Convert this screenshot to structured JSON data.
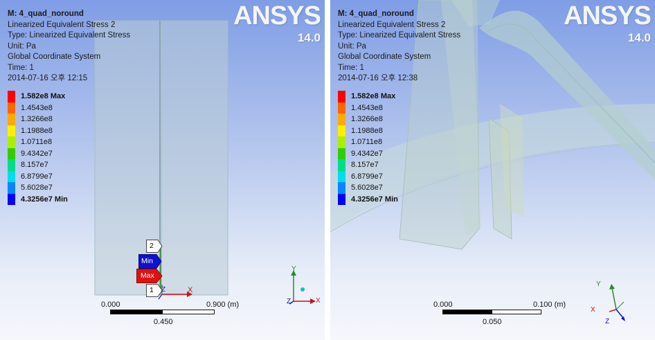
{
  "left": {
    "info": {
      "title": "M: 4_quad_noround",
      "result": "Linearized Equivalent Stress 2",
      "type": "Type: Linearized Equivalent Stress",
      "unit": "Unit: Pa",
      "coord": "Global Coordinate System",
      "time": "Time: 1",
      "date": "2014-07-16 오후 12:15"
    },
    "logo": {
      "brand": "ANSYS",
      "version": "14.0"
    },
    "scale": {
      "start": "0.000",
      "end": "0.900 (m)",
      "mid": "0.450"
    },
    "probes": {
      "label_2": "2",
      "label_min": "Min",
      "label_max": "Max",
      "label_1": "1"
    },
    "triad": {
      "x": "X",
      "y": "Y",
      "z": "Z"
    },
    "path_triad": {
      "x": "X",
      "z": "Z"
    }
  },
  "right": {
    "info": {
      "title": "M: 4_quad_noround",
      "result": "Linearized Equivalent Stress 2",
      "type": "Type: Linearized Equivalent Stress",
      "unit": "Unit: Pa",
      "coord": "Global Coordinate System",
      "time": "Time: 1",
      "date": "2014-07-16 오후 12:38"
    },
    "logo": {
      "brand": "ANSYS",
      "version": "14.0"
    },
    "scale": {
      "start": "0.000",
      "end": "0.100 (m)",
      "mid": "0.050"
    },
    "triad": {
      "x": "X",
      "y": "Y",
      "z": "Z"
    }
  },
  "legend": [
    {
      "value": "1.582e8 Max",
      "color": "#ff0000",
      "bold": true
    },
    {
      "value": "1.4543e8",
      "color": "#ff6600",
      "bold": false
    },
    {
      "value": "1.3266e8",
      "color": "#ffaa00",
      "bold": false
    },
    {
      "value": "1.1988e8",
      "color": "#ffee00",
      "bold": false
    },
    {
      "value": "1.0711e8",
      "color": "#aaee00",
      "bold": false
    },
    {
      "value": "9.4342e7",
      "color": "#33cc00",
      "bold": false
    },
    {
      "value": "8.157e7",
      "color": "#00dd88",
      "bold": false
    },
    {
      "value": "6.8799e7",
      "color": "#00ddee",
      "bold": false
    },
    {
      "value": "5.6028e7",
      "color": "#0088ff",
      "bold": false
    },
    {
      "value": "4.3256e7 Min",
      "color": "#0000ff",
      "bold": true
    }
  ],
  "colors": {
    "min_tag": "#1010d0",
    "max_tag": "#e01010",
    "model_face": "#b8ccd6"
  }
}
